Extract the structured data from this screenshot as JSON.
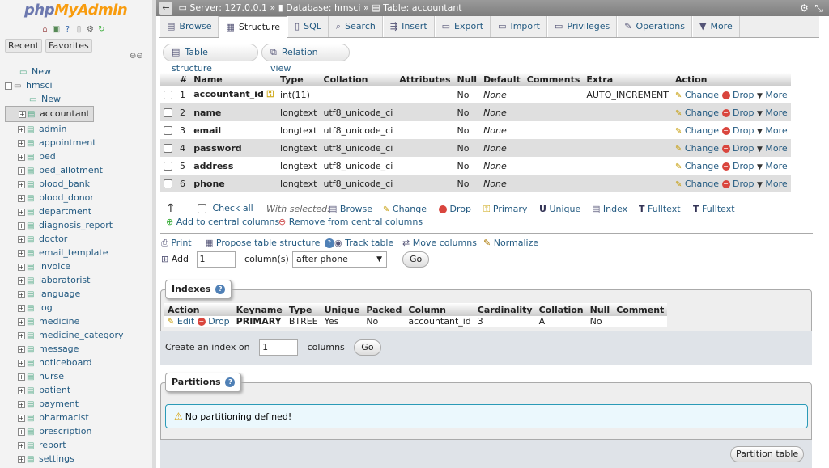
{
  "nav": {
    "logo_a": "php",
    "logo_b": "MyAdmin",
    "tab_recent": "Recent",
    "tab_favorites": "Favorites",
    "new_root": "New",
    "db_name": "hmsci",
    "db_new": "New",
    "tables": [
      "accountant",
      "admin",
      "appointment",
      "bed",
      "bed_allotment",
      "blood_bank",
      "blood_donor",
      "department",
      "diagnosis_report",
      "doctor",
      "email_template",
      "invoice",
      "laboratorist",
      "language",
      "log",
      "medicine",
      "medicine_category",
      "message",
      "noticeboard",
      "nurse",
      "patient",
      "payment",
      "pharmacist",
      "prescription",
      "report",
      "settings"
    ],
    "selected_table": "accountant"
  },
  "topbar": {
    "server": "Server: 127.0.0.1",
    "database": "Database: hmsci",
    "table": "Table: accountant",
    "sep": "»"
  },
  "tabs": [
    "Browse",
    "Structure",
    "SQL",
    "Search",
    "Insert",
    "Export",
    "Import",
    "Privileges",
    "Operations",
    "More"
  ],
  "active_tab": "Structure",
  "subnav": {
    "table_structure": "Table structure",
    "relation_view": "Relation view"
  },
  "columns_header": [
    "#",
    "Name",
    "Type",
    "Collation",
    "Attributes",
    "Null",
    "Default",
    "Comments",
    "Extra",
    "Action"
  ],
  "columns": [
    {
      "num": "1",
      "name": "accountant_id",
      "type": "int(11)",
      "collation": "",
      "attributes": "",
      "null": "No",
      "default": "None",
      "comments": "",
      "extra": "AUTO_INCREMENT"
    },
    {
      "num": "2",
      "name": "name",
      "type": "longtext",
      "collation": "utf8_unicode_ci",
      "attributes": "",
      "null": "No",
      "default": "None",
      "comments": "",
      "extra": ""
    },
    {
      "num": "3",
      "name": "email",
      "type": "longtext",
      "collation": "utf8_unicode_ci",
      "attributes": "",
      "null": "No",
      "default": "None",
      "comments": "",
      "extra": ""
    },
    {
      "num": "4",
      "name": "password",
      "type": "longtext",
      "collation": "utf8_unicode_ci",
      "attributes": "",
      "null": "No",
      "default": "None",
      "comments": "",
      "extra": ""
    },
    {
      "num": "5",
      "name": "address",
      "type": "longtext",
      "collation": "utf8_unicode_ci",
      "attributes": "",
      "null": "No",
      "default": "None",
      "comments": "",
      "extra": ""
    },
    {
      "num": "6",
      "name": "phone",
      "type": "longtext",
      "collation": "utf8_unicode_ci",
      "attributes": "",
      "null": "No",
      "default": "None",
      "comments": "",
      "extra": ""
    }
  ],
  "row_actions": {
    "change": "Change",
    "drop": "Drop",
    "more": "More"
  },
  "bulk": {
    "check_all": "Check all",
    "with_selected": "With selected:",
    "browse": "Browse",
    "change": "Change",
    "drop": "Drop",
    "primary": "Primary",
    "unique": "Unique",
    "index": "Index",
    "fulltext": "Fulltext",
    "fulltext2": "Fulltext",
    "add_central": "Add to central columns",
    "remove_central": "Remove from central columns"
  },
  "tools": {
    "print": "Print",
    "propose": "Propose table structure",
    "track": "Track table",
    "move": "Move columns",
    "normalize": "Normalize"
  },
  "add_row": {
    "label": "Add",
    "count": "1",
    "columns_label": "column(s)",
    "position": "after phone",
    "go": "Go"
  },
  "indexes": {
    "legend": "Indexes",
    "header": [
      "Action",
      "Keyname",
      "Type",
      "Unique",
      "Packed",
      "Column",
      "Cardinality",
      "Collation",
      "Null",
      "Comment"
    ],
    "row": {
      "edit": "Edit",
      "drop": "Drop",
      "keyname": "PRIMARY",
      "type": "BTREE",
      "unique": "Yes",
      "packed": "No",
      "column": "accountant_id",
      "cardinality": "3",
      "collation": "A",
      "null": "No",
      "comment": ""
    },
    "create_label": "Create an index on",
    "create_count": "1",
    "create_columns": "columns",
    "go": "Go"
  },
  "partitions": {
    "legend": "Partitions",
    "notice": "No partitioning defined!",
    "button": "Partition table"
  }
}
